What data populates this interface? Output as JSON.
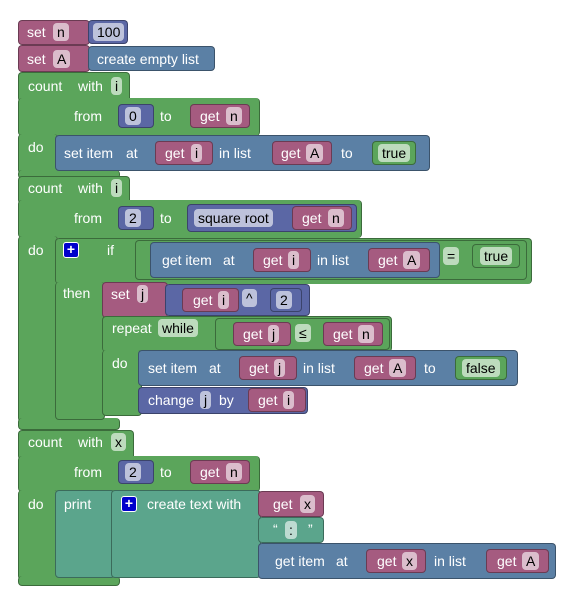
{
  "kw": {
    "set": "set",
    "count": "count",
    "with": "with",
    "from": "from",
    "to": "to",
    "do": "do",
    "get": "get",
    "set_item": "set item",
    "at": "at",
    "in_list": "in list",
    "to_kw": "to",
    "if": "if",
    "then": "then",
    "repeat": "repeat",
    "while": "while",
    "change": "change",
    "by": "by",
    "print": "print",
    "create_text_with": "create text with",
    "get_item": "get item",
    "create_empty_list": "create empty list",
    "square_root": "square root",
    "open_quote": "“",
    "close_quote": "”"
  },
  "vars": {
    "n": "n",
    "A": "A",
    "i": "i",
    "j": "j",
    "x": "x"
  },
  "values": {
    "n_init": "100",
    "from0": "0",
    "from2": "2",
    "from2b": "2",
    "pow": "2",
    "true1": "true",
    "true2": "true",
    "false": "false",
    "sep": ":"
  },
  "ops": {
    "eq": "=",
    "pow": "^",
    "le": "≤"
  },
  "colors": {
    "variables": "#a55b80",
    "lists": "#5b80a5",
    "loops_logic": "#5ba55b",
    "math": "#5b67a5",
    "text": "#5ba58c",
    "mutator": "#0000cc"
  }
}
